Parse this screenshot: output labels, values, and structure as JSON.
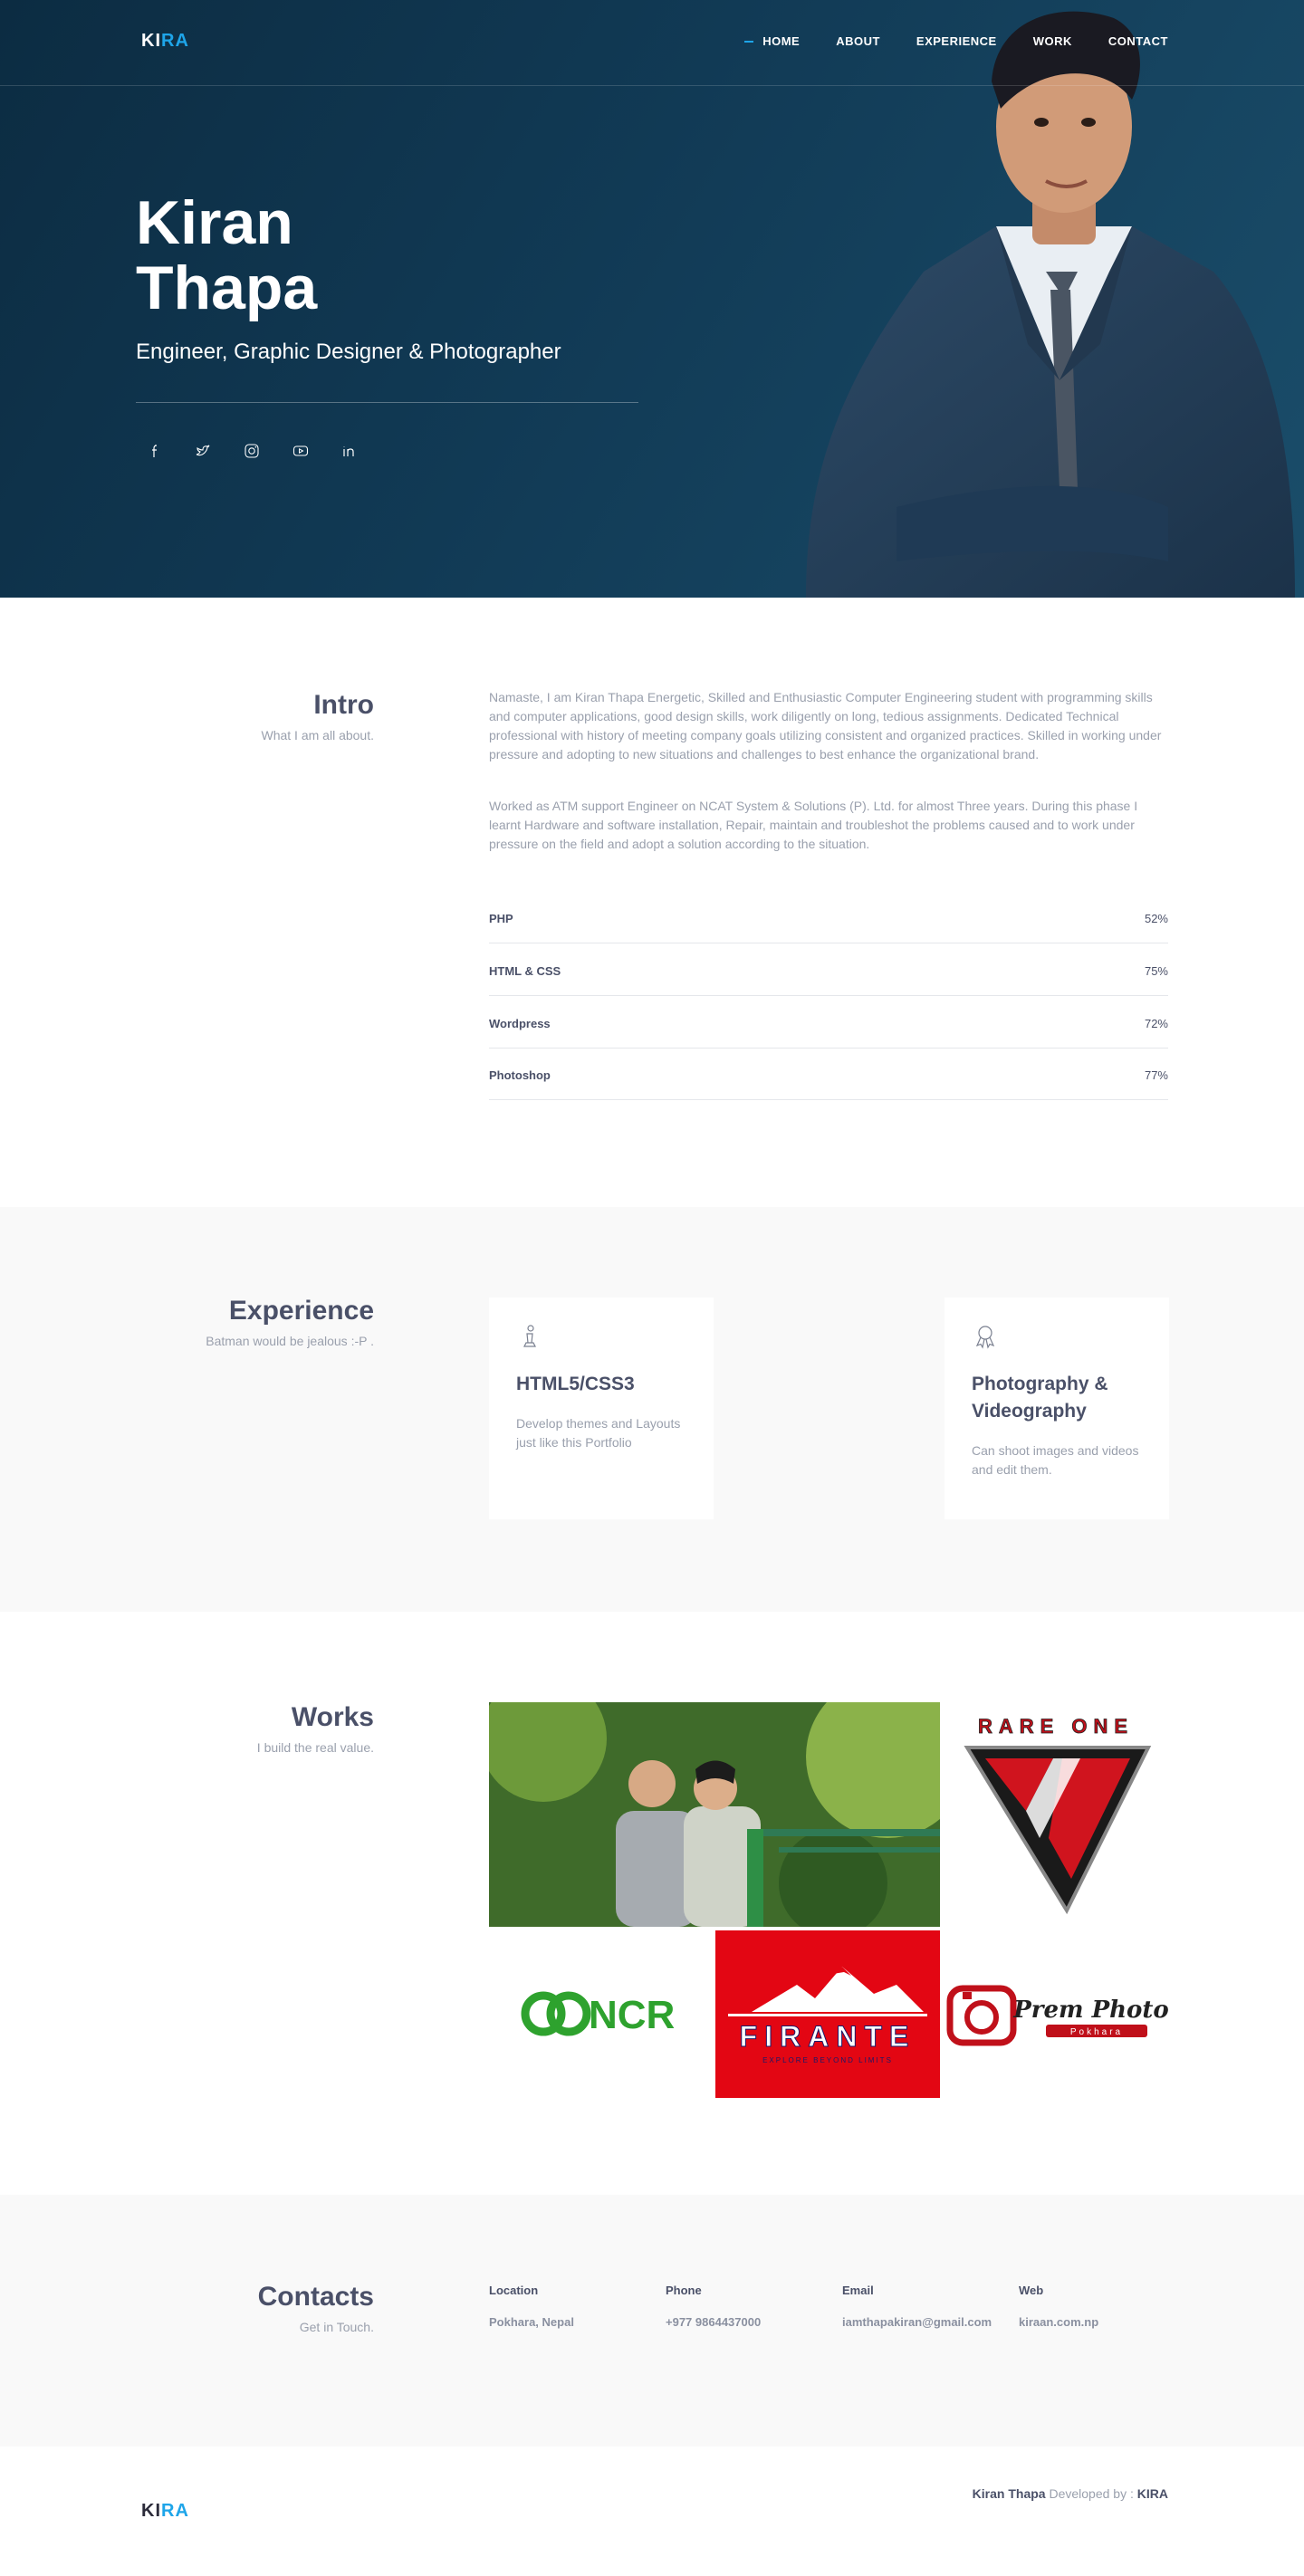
{
  "brand": {
    "logo_part1": "KI",
    "logo_part2": "RA"
  },
  "nav": {
    "items": [
      "HOME",
      "ABOUT",
      "EXPERIENCE",
      "WORK",
      "CONTACT"
    ],
    "active": "HOME"
  },
  "hero": {
    "first_name": "Kiran",
    "last_name": "Thapa",
    "subtitle": "Engineer, Graphic Designer & Photographer",
    "social_icons": [
      "facebook-icon",
      "twitter-icon",
      "instagram-icon",
      "youtube-icon",
      "linkedin-icon"
    ]
  },
  "intro": {
    "title": "Intro",
    "subtitle": "What I am all about.",
    "paragraph1": "Namaste, I am Kiran Thapa Energetic, Skilled and Enthusiastic Computer Engineering student with programming skills and computer applications, good design skills, work diligently on long, tedious assignments. Dedicated Technical professional with history of meeting company goals utilizing consistent and organized practices. Skilled in working under pressure and adopting to new situations and challenges to best enhance the organizational brand.",
    "paragraph2": "Worked as ATM support Engineer on NCAT System & Solutions (P). Ltd. for almost Three years. During this phase I learnt Hardware and software installation, Repair, maintain and troubleshot the problems caused and to work under pressure on the field and adopt a solution according to the situation.",
    "skills": [
      {
        "name": "PHP",
        "value": "52%"
      },
      {
        "name": "HTML & CSS",
        "value": "75%"
      },
      {
        "name": "Wordpress",
        "value": "72%"
      },
      {
        "name": "Photoshop",
        "value": "77%"
      }
    ]
  },
  "experience": {
    "title": "Experience",
    "subtitle": "Batman would be jealous :-P .",
    "cards": [
      {
        "icon": "chess-pawn-icon",
        "title": "HTML5/CSS3",
        "description": "Develop themes and Layouts just like this Portfolio"
      },
      {
        "icon": "award-ribbon-icon",
        "title": "Photography & Videography",
        "description": "Can shoot images and videos and edit them."
      }
    ]
  },
  "works": {
    "title": "Works",
    "subtitle": "I build the real value.",
    "items": [
      {
        "name": "couple-photo"
      },
      {
        "name": "rare-one-logo",
        "text": "RARE ONE"
      },
      {
        "name": "ncr-logo",
        "text": "NCR"
      },
      {
        "name": "firante-logo",
        "text": "FIRANTE",
        "tagline": "EXPLORE BEYOND LIMITS"
      },
      {
        "name": "prem-photo-logo",
        "text": "Prem Photo",
        "subtext": "Pokhara"
      }
    ]
  },
  "contacts": {
    "title": "Contacts",
    "subtitle": "Get in Touch.",
    "location_label": "Location",
    "location_value": "Pokhara, Nepal",
    "phone_label": "Phone",
    "phone_value": "+977 9864437000",
    "email_label": "Email",
    "email_value": "iamthapakiran@gmail.com",
    "web_label": "Web",
    "web_value": "kiraan.com.np"
  },
  "footer": {
    "author": "Kiran Thapa",
    "developed_by": "Developed by :",
    "dev_name": "KIRA"
  },
  "colors": {
    "accent": "#1ea5e9",
    "hero_bg": "#113a55",
    "text_dark": "#4a5068",
    "text_muted": "#9aa0ad",
    "firante_red": "#e30613",
    "ncr_green": "#2ea22e"
  }
}
